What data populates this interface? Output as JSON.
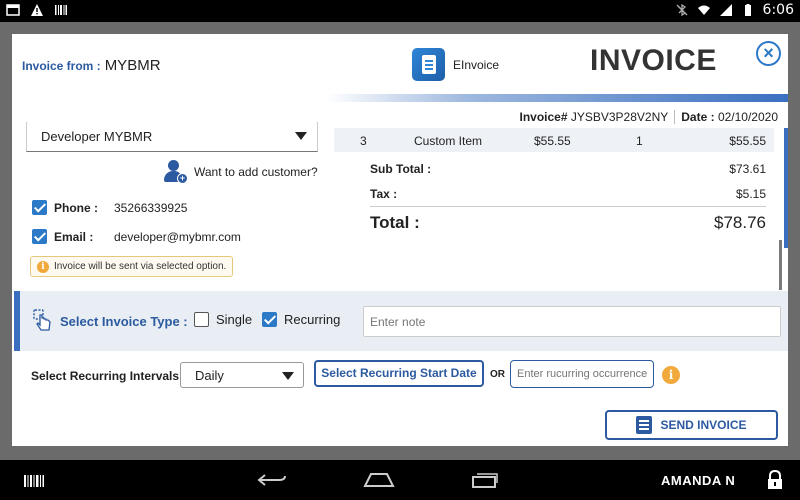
{
  "status_bar": {
    "time": "6:06"
  },
  "dialog": {
    "from_label": "Invoice from :",
    "from_name": "MYBMR",
    "app_name": "EInvoice",
    "title": "INVOICE",
    "invoice_no_label": "Invoice#",
    "invoice_no": "JYSBV3P28V2NY",
    "date_label": "Date :",
    "date": "02/10/2020"
  },
  "customer": {
    "selected": "Developer MYBMR",
    "add_prompt": "Want to add customer?",
    "phone_label": "Phone :",
    "phone": "35266339925",
    "email_label": "Email :",
    "email": "developer@mybmr.com",
    "send_note": "Invoice will be sent via selected option."
  },
  "items": {
    "rows": [
      {
        "no": "3",
        "name": "Custom Item",
        "price": "$55.55",
        "qty": "1",
        "amount": "$55.55"
      }
    ],
    "subtotal_label": "Sub Total :",
    "subtotal": "$73.61",
    "tax_label": "Tax :",
    "tax": "$5.15",
    "total_label": "Total :",
    "total": "$78.76"
  },
  "invoice_type": {
    "label": "Select Invoice Type :",
    "options": [
      {
        "label": "Single",
        "checked": false
      },
      {
        "label": "Recurring",
        "checked": true
      }
    ],
    "note_placeholder": "Enter note"
  },
  "recurring": {
    "intervals_label": "Select Recurring Intervals :",
    "interval_value": "Daily",
    "start_date_button": "Select Recurring Start Date",
    "or": "OR",
    "occurrence_placeholder": "Enter rucurring occurrence"
  },
  "send_button": "SEND INVOICE",
  "nav_bar": {
    "user": "AMANDA N"
  },
  "colors": {
    "accent": "#2c5aa0",
    "link_blue": "#2c79c8",
    "band": "#e9eef5",
    "info": "#f2a93b"
  }
}
